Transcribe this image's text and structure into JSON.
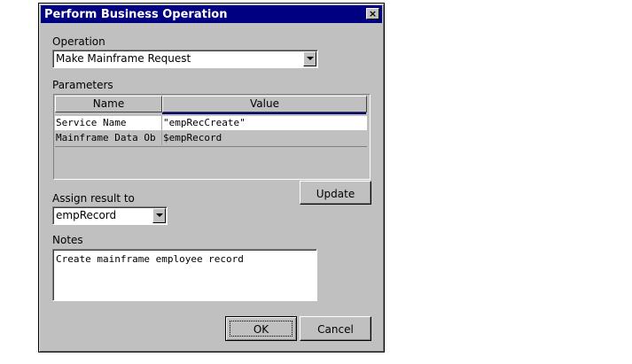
{
  "dialog": {
    "title": "Perform Business Operation",
    "close_glyph": "×"
  },
  "operation": {
    "label": "Operation",
    "value": "Make Mainframe Request"
  },
  "parameters": {
    "label": "Parameters",
    "columns": [
      "Name",
      "Value"
    ],
    "rows": [
      {
        "name": "Service Name",
        "value": "\"empRecCreate\""
      },
      {
        "name": "Mainframe Data Ob",
        "value": "$empRecord"
      }
    ]
  },
  "update_label": "Update",
  "assign": {
    "label": "Assign result to",
    "value": "empRecord"
  },
  "notes": {
    "label": "Notes",
    "value": "Create mainframe employee record"
  },
  "buttons": {
    "ok": "OK",
    "cancel": "Cancel"
  },
  "colors": {
    "title_bar": "#000080",
    "dialog_face": "#c0c0c0",
    "selected_row": "#c0c0c0"
  }
}
